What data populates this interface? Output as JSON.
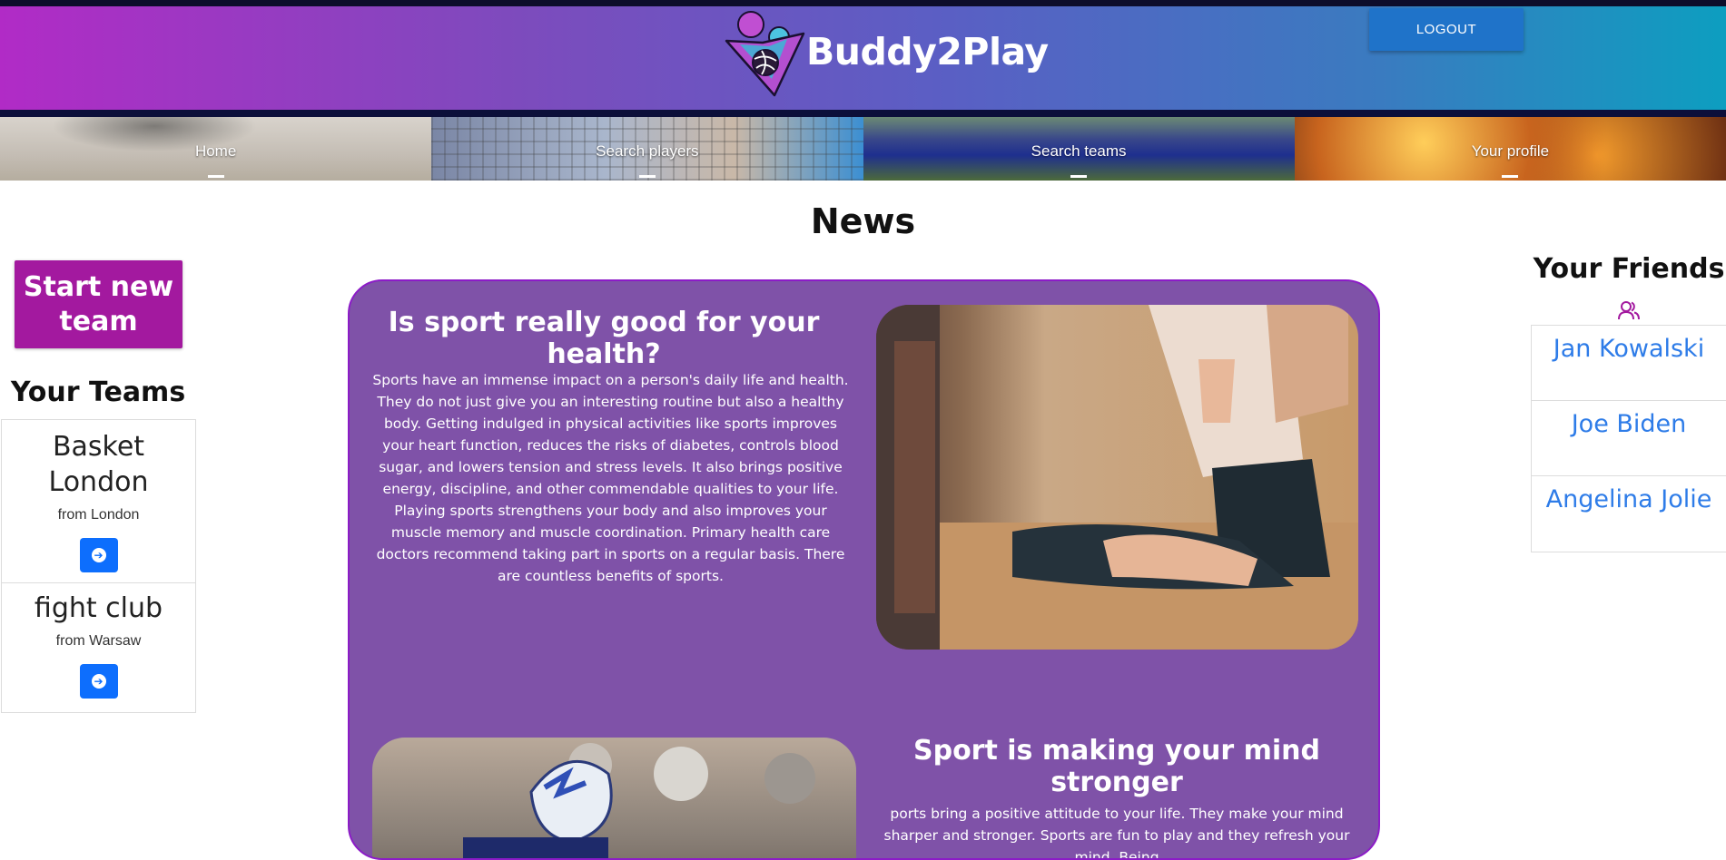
{
  "header": {
    "brand": "Buddy2Play",
    "logout_label": "LOGOUT",
    "colors": {
      "gradient_start": "#b12bc6",
      "gradient_end": "#0d9ec0",
      "logout_bg": "#1f73c9"
    }
  },
  "nav": {
    "items": [
      {
        "label": "Home",
        "icon": "basketball-photo"
      },
      {
        "label": "Search players",
        "icon": "volleyball-photo"
      },
      {
        "label": "Search teams",
        "icon": "rugby-photo"
      },
      {
        "label": "Your profile",
        "icon": "fireworks-photo"
      }
    ]
  },
  "main": {
    "title": "News",
    "articles": [
      {
        "title": "Is sport really good for your health?",
        "body": "Sports have an immense impact on a person's daily life and health. They do not just give you an interesting routine but also a healthy body. Getting indulged in physical activities like sports improves your heart function, reduces the risks of diabetes, controls blood sugar, and lowers tension and stress levels. It also brings positive energy, discipline, and other commendable qualities to your life. Playing sports strengthens your body and also improves your muscle memory and muscle coordination. Primary health care doctors recommend taking part in sports on a regular basis. There are countless benefits of sports.",
        "image": "yoga-photo"
      },
      {
        "title": "Sport is making your mind stronger",
        "body": "ports bring a positive attitude to your life. They make your mind sharper and stronger. Sports are fun to play and they refresh your mind. Being",
        "image": "american-football-photo"
      }
    ],
    "colors": {
      "feed_bg": "#7f52a8",
      "feed_border": "#8c1bc7"
    }
  },
  "left": {
    "start_button": "Start new team",
    "teams_title": "Your Teams",
    "teams": [
      {
        "name": "Basket London",
        "from": "from London"
      },
      {
        "name": "fight club",
        "from": "from Warsaw"
      }
    ],
    "colors": {
      "start_bg": "#a3199f",
      "go_button": "#0d6efd"
    }
  },
  "right": {
    "friends_title": "Your Friends",
    "friends_icon": "people-icon",
    "friends": [
      "Jan Kowalski",
      "Joe Biden",
      "Angelina Jolie"
    ],
    "colors": {
      "friend_link": "#2e7ce8"
    }
  }
}
